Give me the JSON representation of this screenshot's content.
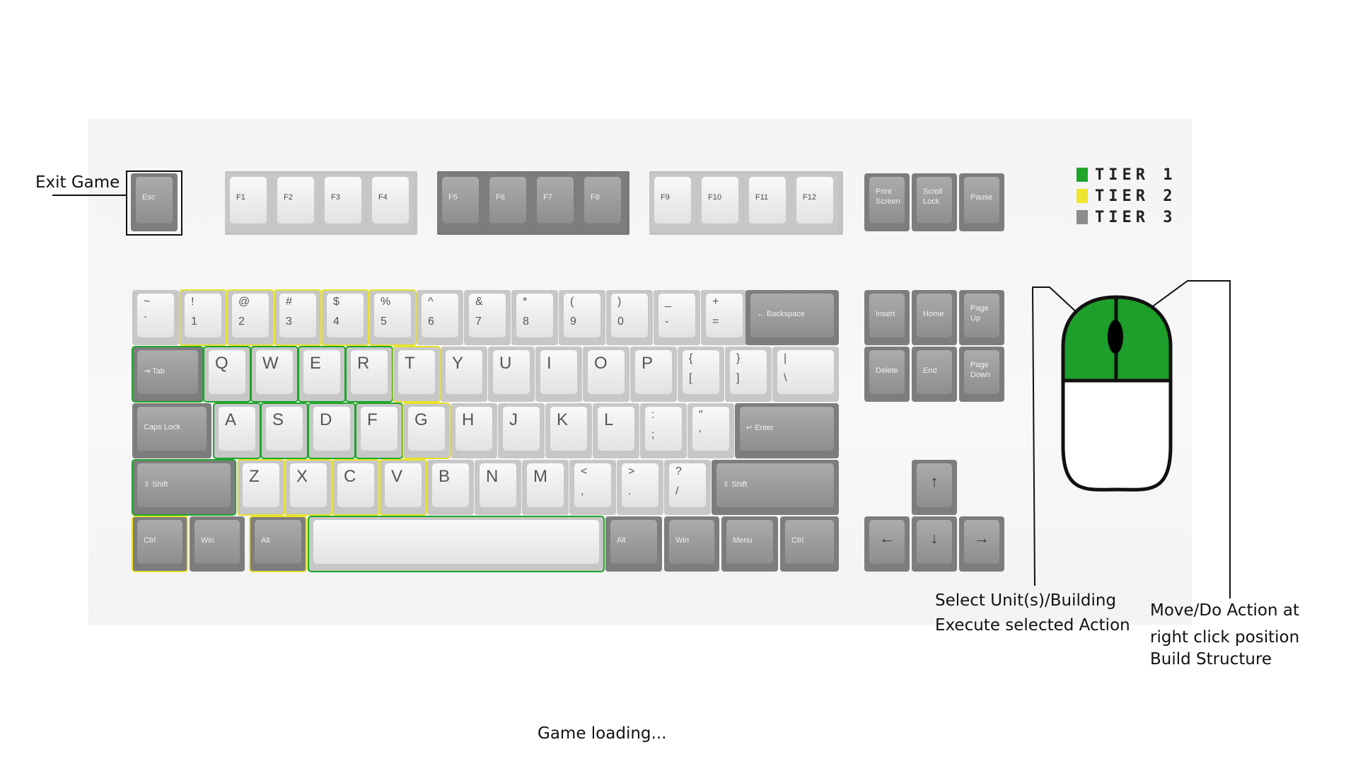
{
  "annotations": {
    "exit_game": "Exit Game",
    "left_click_line1": "Select Unit(s)/Building",
    "left_click_line2": "Execute selected Action",
    "right_click_line1": "Move/Do Action at",
    "right_click_line2": "right click position",
    "right_click_line3": "Build Structure"
  },
  "status": {
    "loading": "Game loading..."
  },
  "legend": [
    {
      "label": "TIER 1",
      "color": "#1ea52a"
    },
    {
      "label": "TIER 2",
      "color": "#ece62e"
    },
    {
      "label": "TIER 3",
      "color": "#8c8c8c"
    }
  ],
  "colors": {
    "tier1": "#1ea52a",
    "tier2": "#e8e22a",
    "tier3": "#8c8c8c",
    "mouse_left_button": "#1e9e2a"
  },
  "icons": {
    "mouse": "mouse-icon"
  },
  "keys": {
    "esc": "Esc",
    "f1": "F1",
    "f2": "F2",
    "f3": "F3",
    "f4": "F4",
    "f5": "F5",
    "f6": "F6",
    "f7": "F7",
    "f8": "F8",
    "f9": "F9",
    "f10": "F10",
    "f11": "F11",
    "f12": "F12",
    "print_screen_1": "Print",
    "print_screen_2": "Screen",
    "scroll_lock_1": "Scroll",
    "scroll_lock_2": "Lock",
    "pause": "Pause",
    "grave_top": "~",
    "grave_bottom": "`",
    "n1_top": "!",
    "n1_bottom": "1",
    "n2_top": "@",
    "n2_bottom": "2",
    "n3_top": "#",
    "n3_bottom": "3",
    "n4_top": "$",
    "n4_bottom": "4",
    "n5_top": "%",
    "n5_bottom": "5",
    "n6_top": "^",
    "n6_bottom": "6",
    "n7_top": "&",
    "n7_bottom": "7",
    "n8_top": "*",
    "n8_bottom": "8",
    "n9_top": "(",
    "n9_bottom": "9",
    "n0_top": ")",
    "n0_bottom": "0",
    "minus_top": "_",
    "minus_bottom": "-",
    "plus_top": "+",
    "plus_bottom": "=",
    "backspace": "← Backspace",
    "tab": "⇥ Tab",
    "q": "Q",
    "w": "W",
    "e": "E",
    "r": "R",
    "t": "T",
    "y": "Y",
    "u": "U",
    "i": "I",
    "o": "O",
    "p": "P",
    "lbrace_top": "{",
    "lbrace_bottom": "[",
    "rbrace_top": "}",
    "rbrace_bottom": "]",
    "pipe_top": "|",
    "pipe_bottom": "\\",
    "caps_lock": "Caps Lock",
    "a": "A",
    "s": "S",
    "d": "D",
    "f": "F",
    "g": "G",
    "h": "H",
    "j": "J",
    "k": "K",
    "l": "L",
    "semicolon_top": ":",
    "semicolon_bottom": ";",
    "quote_top": "\"",
    "quote_bottom": "'",
    "enter": "↵ Enter",
    "shift": "⇧ Shift",
    "z": "Z",
    "x": "X",
    "c": "C",
    "v": "V",
    "b": "B",
    "n": "N",
    "m": "M",
    "comma_top": "<",
    "comma_bottom": ",",
    "period_top": ">",
    "period_bottom": ".",
    "slash_top": "?",
    "slash_bottom": "/",
    "ctrl": "Ctrl",
    "win": "Win",
    "alt": "Alt",
    "menu": "Menu",
    "insert": "Insert",
    "home": "Home",
    "page_up_1": "Page",
    "page_up_2": "Up",
    "delete": "Delete",
    "end": "End",
    "page_down_1": "Page",
    "page_down_2": "Down",
    "arrow_up": "↑",
    "arrow_left": "←",
    "arrow_down": "↓",
    "arrow_right": "→"
  }
}
